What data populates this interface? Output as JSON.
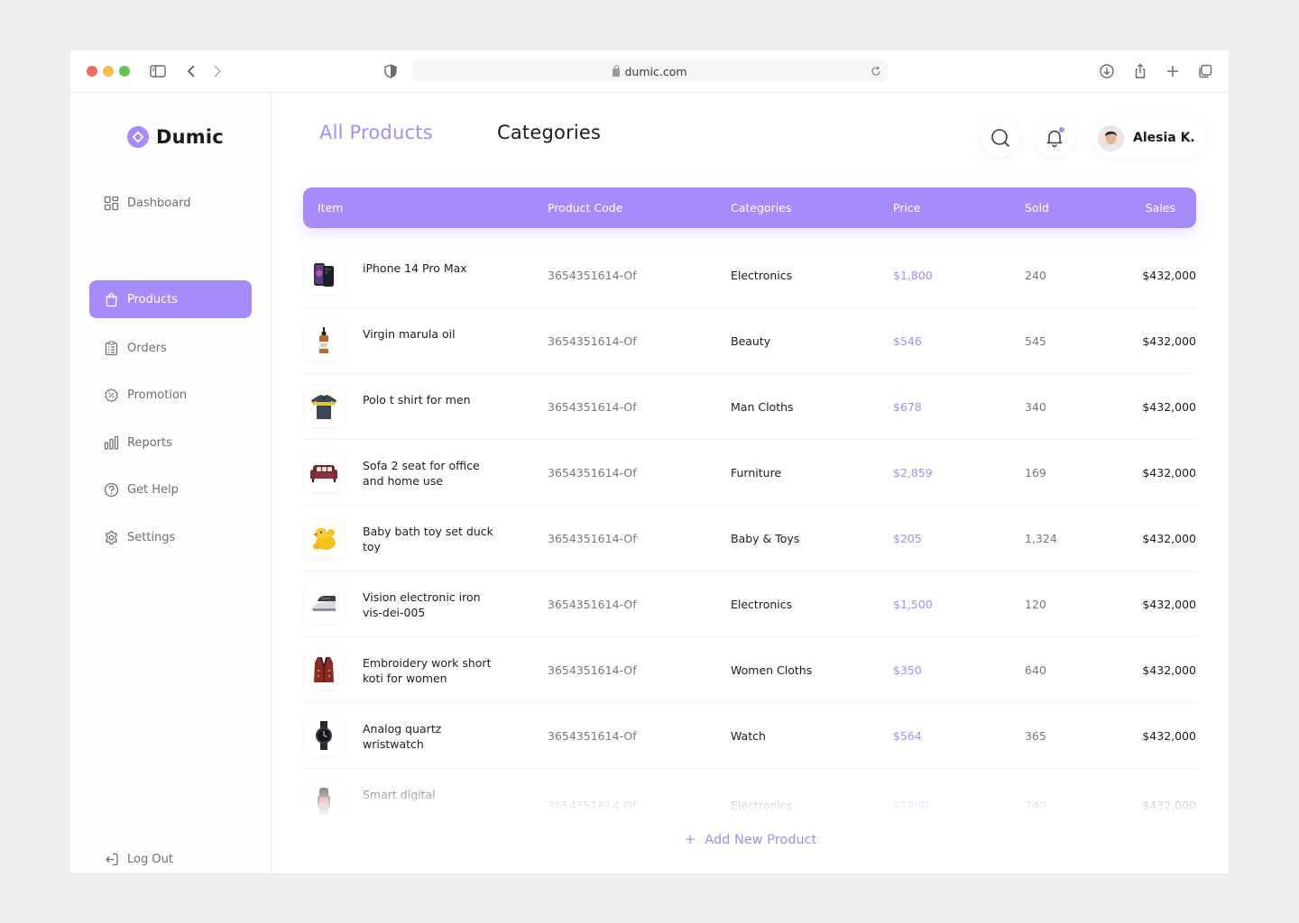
{
  "browser": {
    "url": "dumic.com"
  },
  "sidebar": {
    "brand": "Dumic",
    "items": [
      {
        "label": "Dashboard",
        "icon": "dashboard-icon"
      },
      {
        "label": "Products",
        "icon": "shopping-bag-icon"
      },
      {
        "label": "Orders",
        "icon": "clipboard-list-icon"
      },
      {
        "label": "Promotion",
        "icon": "discount-icon"
      },
      {
        "label": "Reports",
        "icon": "bar-chart-icon"
      },
      {
        "label": "Get Help",
        "icon": "help-circle-icon"
      },
      {
        "label": "Settings",
        "icon": "gear-icon"
      }
    ],
    "logout": "Log Out"
  },
  "header": {
    "tabs": [
      {
        "label": "All Products",
        "active": true
      },
      {
        "label": "Categories",
        "active": false
      }
    ],
    "user_name": "Alesia K."
  },
  "table": {
    "columns": [
      "Item",
      "Product Code",
      "Categories",
      "Price",
      "Sold",
      "Sales"
    ],
    "rows": [
      {
        "name": "iPhone 14 Pro Max",
        "code": "3654351614-Of",
        "category": "Electronics",
        "price": "$1,800",
        "sold": "240",
        "sales": "$432,000",
        "thumb": "phone"
      },
      {
        "name": "Virgin marula oil",
        "code": "3654351614-Of",
        "category": "Beauty",
        "price": "$546",
        "sold": "545",
        "sales": "$432,000",
        "thumb": "bottle"
      },
      {
        "name": "Polo t shirt for men",
        "code": "3654351614-Of",
        "category": "Man Cloths",
        "price": "$678",
        "sold": "340",
        "sales": "$432,000",
        "thumb": "shirt"
      },
      {
        "name": "Sofa 2 seat for office and home use",
        "code": "3654351614-Of",
        "category": "Furniture",
        "price": "$2,859",
        "sold": "169",
        "sales": "$432,000",
        "thumb": "sofa"
      },
      {
        "name": "Baby bath toy set duck toy",
        "code": "3654351614-Of",
        "category": "Baby & Toys",
        "price": "$205",
        "sold": "1,324",
        "sales": "$432,000",
        "thumb": "duck"
      },
      {
        "name": "Vision electronic iron vis-dei-005",
        "code": "3654351614-Of",
        "category": "Electronics",
        "price": "$1,500",
        "sold": "120",
        "sales": "$432,000",
        "thumb": "iron"
      },
      {
        "name": "Embroidery work short koti for women",
        "code": "3654351614-Of",
        "category": "Women Cloths",
        "price": "$350",
        "sold": "640",
        "sales": "$432,000",
        "thumb": "vest"
      },
      {
        "name": "Analog quartz wristwatch",
        "code": "3654351614-Of",
        "category": "Watch",
        "price": "$564",
        "sold": "365",
        "sales": "$432,000",
        "thumb": "watch"
      },
      {
        "name": "Smart digital",
        "code": "3654351614-Of",
        "category": "Electronics",
        "price": "$1800",
        "sold": "240",
        "sales": "$432,000",
        "thumb": "smartwatch"
      }
    ]
  },
  "actions": {
    "add_new": "Add New Product"
  },
  "colors": {
    "accent": "#a78bfa",
    "text": "#1c1c1f",
    "muted": "#777780"
  }
}
